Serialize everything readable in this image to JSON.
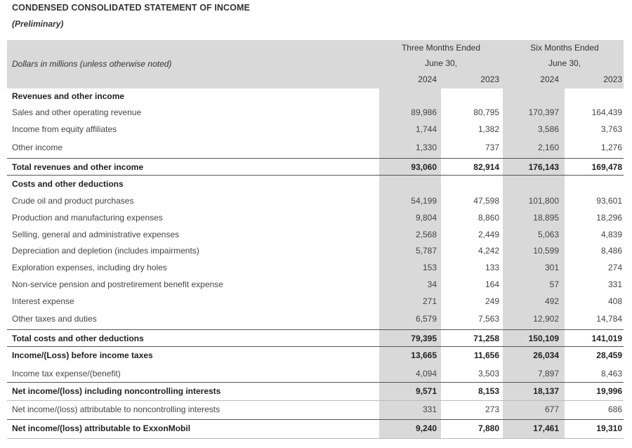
{
  "title": "CONDENSED CONSOLIDATED STATEMENT OF INCOME",
  "subtitle": "(Preliminary)",
  "header": {
    "units": "Dollars in millions (unless otherwise noted)",
    "three_months": "Three Months Ended",
    "six_months": "Six Months Ended",
    "june30": "June 30,",
    "years": [
      "2024",
      "2023",
      "2024",
      "2023"
    ]
  },
  "rows": [
    {
      "label": "Revenues and other income",
      "type": "section",
      "values": [
        "",
        "",
        "",
        ""
      ]
    },
    {
      "label": "Sales and other operating revenue",
      "type": "item",
      "values": [
        "89,986",
        "80,795",
        "170,397",
        "164,439"
      ]
    },
    {
      "label": "Income from equity affiliates",
      "type": "item",
      "values": [
        "1,744",
        "1,382",
        "3,586",
        "3,763"
      ]
    },
    {
      "label": "Other income",
      "type": "item",
      "values": [
        "1,330",
        "737",
        "2,160",
        "1,276"
      ]
    },
    {
      "label": "Total revenues and other income",
      "type": "total",
      "values": [
        "93,060",
        "82,914",
        "176,143",
        "169,478"
      ]
    },
    {
      "label": "Costs and other deductions",
      "type": "section",
      "values": [
        "",
        "",
        "",
        ""
      ]
    },
    {
      "label": "Crude oil and product purchases",
      "type": "item",
      "values": [
        "54,199",
        "47,598",
        "101,800",
        "93,601"
      ]
    },
    {
      "label": "Production and manufacturing expenses",
      "type": "item",
      "values": [
        "9,804",
        "8,860",
        "18,895",
        "18,296"
      ]
    },
    {
      "label": "Selling, general and administrative expenses",
      "type": "item",
      "values": [
        "2,568",
        "2,449",
        "5,063",
        "4,839"
      ]
    },
    {
      "label": "Depreciation and depletion (includes impairments)",
      "type": "item",
      "values": [
        "5,787",
        "4,242",
        "10,599",
        "8,486"
      ]
    },
    {
      "label": "Exploration expenses, including dry holes",
      "type": "item",
      "values": [
        "153",
        "133",
        "301",
        "274"
      ]
    },
    {
      "label": "Non-service pension and postretirement benefit expense",
      "type": "item",
      "values": [
        "34",
        "164",
        "57",
        "331"
      ]
    },
    {
      "label": "Interest expense",
      "type": "item",
      "values": [
        "271",
        "249",
        "492",
        "408"
      ]
    },
    {
      "label": "Other taxes and duties",
      "type": "item",
      "values": [
        "6,579",
        "7,563",
        "12,902",
        "14,784"
      ]
    },
    {
      "label": "Total costs and other deductions",
      "type": "total",
      "values": [
        "79,395",
        "71,258",
        "150,109",
        "141,019"
      ]
    },
    {
      "label": "Income/(Loss) before income taxes",
      "type": "subtotal",
      "values": [
        "13,665",
        "11,656",
        "26,034",
        "28,459"
      ]
    },
    {
      "label": "Income tax expense/(benefit)",
      "type": "item",
      "values": [
        "4,094",
        "3,503",
        "7,897",
        "8,463"
      ]
    },
    {
      "label": "Net income/(loss) including noncontrolling interests",
      "type": "total",
      "values": [
        "9,571",
        "8,153",
        "18,137",
        "19,996"
      ]
    },
    {
      "label": "Net income/(loss) attributable to noncontrolling interests",
      "type": "item",
      "values": [
        "331",
        "273",
        "677",
        "686"
      ]
    },
    {
      "label": "Net income/(loss) attributable to ExxonMobil",
      "type": "total",
      "values": [
        "9,240",
        "7,880",
        "17,461",
        "19,310"
      ]
    }
  ]
}
